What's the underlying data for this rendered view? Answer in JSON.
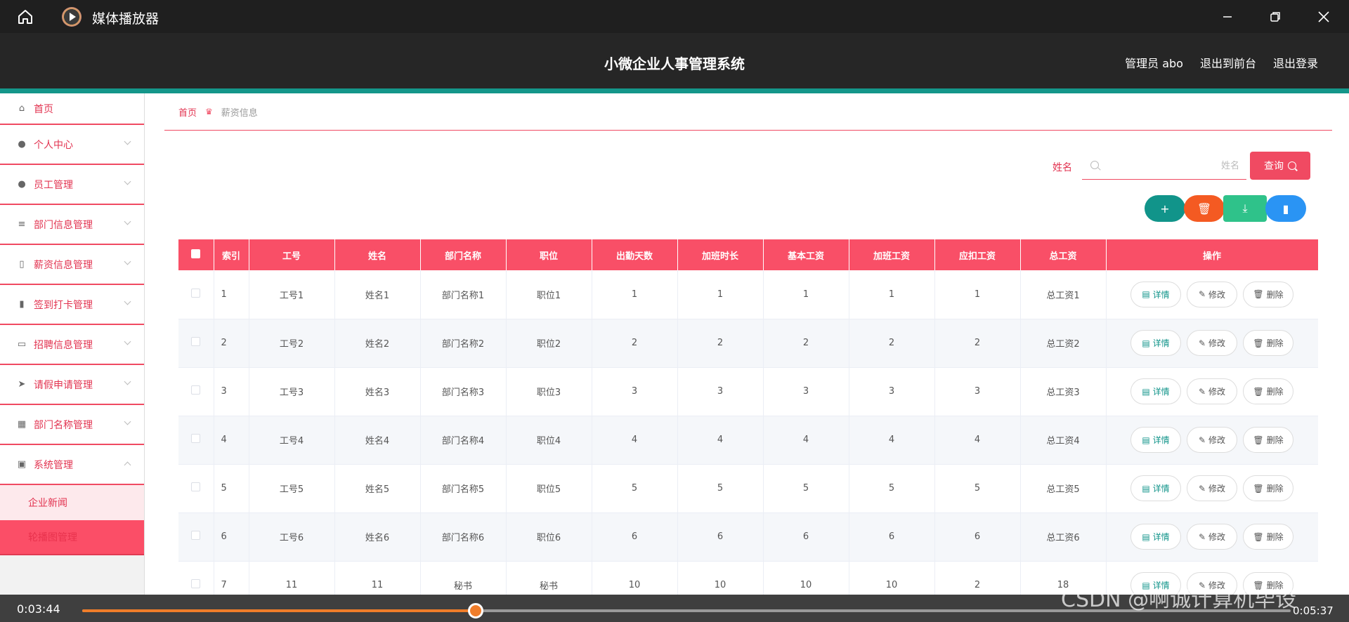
{
  "player": {
    "title": "媒体播放器",
    "time_current": "0:03:44",
    "time_total": "0:05:37",
    "progress": 0.3256,
    "watermark": "CSDN @啊诚计算机毕设"
  },
  "header": {
    "title": "小微企业人事管理系统",
    "admin": "管理员 abo",
    "to_front": "退出到前台",
    "logout": "退出登录"
  },
  "sidebar": {
    "items": [
      {
        "label": "首页",
        "icon": "home-icon"
      },
      {
        "label": "个人中心",
        "icon": "user-icon"
      },
      {
        "label": "员工管理",
        "icon": "bulb-icon"
      },
      {
        "label": "部门信息管理",
        "icon": "list-icon"
      },
      {
        "label": "薪资信息管理",
        "icon": "mic-icon"
      },
      {
        "label": "签到打卡管理",
        "icon": "chart-bars-icon"
      },
      {
        "label": "招聘信息管理",
        "icon": "card-icon"
      },
      {
        "label": "请假申请管理",
        "icon": "send-icon"
      },
      {
        "label": "部门名称管理",
        "icon": "grid-icon"
      },
      {
        "label": "系统管理",
        "icon": "clipboard-icon"
      }
    ],
    "sub_items": [
      "企业新闻",
      "轮播图管理"
    ]
  },
  "breadcrumb": {
    "home": "首页",
    "current": "薪资信息"
  },
  "search": {
    "label": "姓名",
    "placeholder": "姓名",
    "button": "查询"
  },
  "table": {
    "headers": [
      "索引",
      "工号",
      "姓名",
      "部门名称",
      "职位",
      "出勤天数",
      "加班时长",
      "基本工资",
      "加班工资",
      "应扣工资",
      "总工资",
      "操作"
    ],
    "rows": [
      [
        "1",
        "工号1",
        "姓名1",
        "部门名称1",
        "职位1",
        "1",
        "1",
        "1",
        "1",
        "1",
        "总工资1"
      ],
      [
        "2",
        "工号2",
        "姓名2",
        "部门名称2",
        "职位2",
        "2",
        "2",
        "2",
        "2",
        "2",
        "总工资2"
      ],
      [
        "3",
        "工号3",
        "姓名3",
        "部门名称3",
        "职位3",
        "3",
        "3",
        "3",
        "3",
        "3",
        "总工资3"
      ],
      [
        "4",
        "工号4",
        "姓名4",
        "部门名称4",
        "职位4",
        "4",
        "4",
        "4",
        "4",
        "4",
        "总工资4"
      ],
      [
        "5",
        "工号5",
        "姓名5",
        "部门名称5",
        "职位5",
        "5",
        "5",
        "5",
        "5",
        "5",
        "总工资5"
      ],
      [
        "6",
        "工号6",
        "姓名6",
        "部门名称6",
        "职位6",
        "6",
        "6",
        "6",
        "6",
        "6",
        "总工资6"
      ],
      [
        "7",
        "11",
        "11",
        "秘书",
        "秘书",
        "10",
        "10",
        "10",
        "10",
        "2",
        "18"
      ]
    ],
    "ops": {
      "detail": "详情",
      "edit": "修改",
      "delete": "删除"
    }
  }
}
